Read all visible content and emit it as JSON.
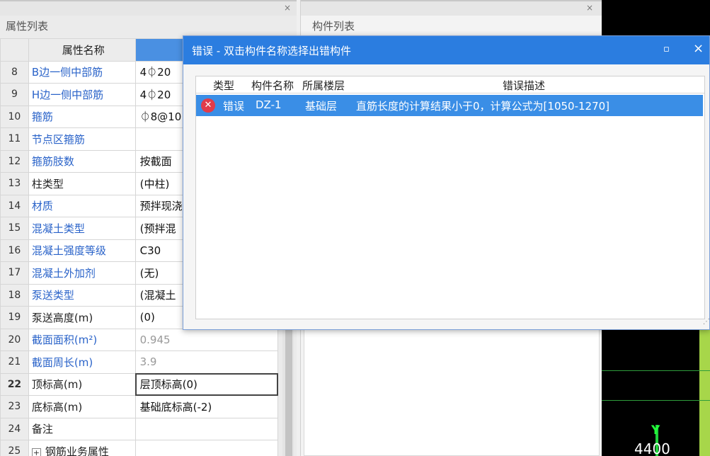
{
  "property_panel": {
    "title": "属性列表",
    "close_icon": "×",
    "header": {
      "num": "",
      "name": "属性名称",
      "value": ""
    },
    "rows": [
      {
        "num": "8",
        "name": "B边一侧中部筋",
        "value": "4⏀20",
        "name_color": "blue"
      },
      {
        "num": "9",
        "name": "H边一侧中部筋",
        "value": "4⏀20",
        "name_color": "blue"
      },
      {
        "num": "10",
        "name": "箍筋",
        "value": "⏀8@10",
        "name_color": "blue"
      },
      {
        "num": "11",
        "name": "节点区箍筋",
        "value": "",
        "name_color": "blue"
      },
      {
        "num": "12",
        "name": "箍筋肢数",
        "value": "按截面",
        "name_color": "blue"
      },
      {
        "num": "13",
        "name": "柱类型",
        "value": "(中柱)",
        "name_color": "black"
      },
      {
        "num": "14",
        "name": "材质",
        "value": "预拌现浇",
        "name_color": "blue"
      },
      {
        "num": "15",
        "name": "混凝土类型",
        "value": "(预拌混",
        "name_color": "blue"
      },
      {
        "num": "16",
        "name": "混凝土强度等级",
        "value": "C30",
        "name_color": "blue"
      },
      {
        "num": "17",
        "name": "混凝土外加剂",
        "value": "(无)",
        "name_color": "blue"
      },
      {
        "num": "18",
        "name": "泵送类型",
        "value": "(混凝土",
        "name_color": "blue"
      },
      {
        "num": "19",
        "name": "泵送高度(m)",
        "value": "(0)",
        "name_color": "black"
      },
      {
        "num": "20",
        "name": "截面面积(m²)",
        "value": "0.945",
        "name_color": "blue",
        "value_grey": true
      },
      {
        "num": "21",
        "name": "截面周长(m)",
        "value": "3.9",
        "name_color": "blue",
        "value_grey": true
      },
      {
        "num": "22",
        "name": "顶标高(m)",
        "value": "层顶标高(0)",
        "name_color": "black",
        "selected": true
      },
      {
        "num": "23",
        "name": "底标高(m)",
        "value": "基础底标高(-2)",
        "name_color": "black"
      },
      {
        "num": "24",
        "name": "备注",
        "value": "",
        "name_color": "black"
      },
      {
        "num": "25",
        "name": "钢筋业务属性",
        "value": "",
        "name_color": "black",
        "expandable": true,
        "expand_symbol": "+"
      }
    ]
  },
  "component_panel": {
    "title": "构件列表",
    "close_icon": "×"
  },
  "error_dialog": {
    "title": "错误 - 双击构件名称选择出错构件",
    "maximize_icon": "▫",
    "close_icon": "×",
    "columns": {
      "type": "类型",
      "name": "构件名称",
      "floor": "所属楼层",
      "desc": "错误描述"
    },
    "rows": [
      {
        "icon": "error-icon",
        "type": "错误",
        "name": "DZ-1",
        "floor": "基础层",
        "desc": "直筋长度的计算结果小于0，计算公式为[1050-1270]"
      }
    ]
  },
  "canvas": {
    "axis_label": "Y",
    "axis_number": "4400"
  },
  "colors": {
    "accent": "#2b7de0",
    "selection": "#3a8ee6",
    "error_red": "#e23b4a",
    "link_blue": "#2a63c9",
    "canvas_green": "#a7d64a"
  }
}
